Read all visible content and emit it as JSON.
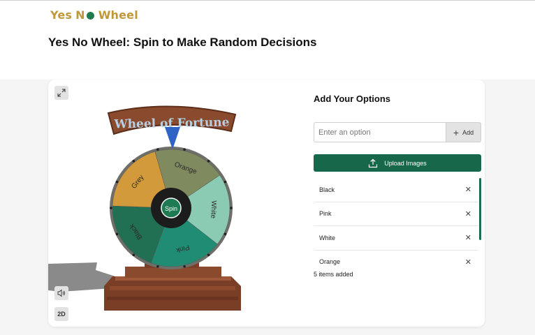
{
  "logo": {
    "part1": "Yes",
    "n": "N",
    "part2": "Wheel"
  },
  "page": {
    "title": "Yes No Wheel: Spin to Make Random Decisions"
  },
  "wheel": {
    "banner": "Wheel of Fortune",
    "spin_label": "Spin",
    "segments": [
      {
        "label": "Orange",
        "color": "#7f8a5f"
      },
      {
        "label": "White",
        "color": "#8ccbb3"
      },
      {
        "label": "Pink",
        "color": "#1f8c73"
      },
      {
        "label": "Black",
        "color": "#217053"
      },
      {
        "label": "Grey",
        "color": "#d39a3b"
      }
    ]
  },
  "controls": {
    "expand_icon": "expand-icon",
    "sound_icon": "speaker-icon",
    "mode_label": "2D"
  },
  "options": {
    "title": "Add Your Options",
    "input_placeholder": "Enter an option",
    "add_label": "Add",
    "upload_label": "Upload Images",
    "items": [
      {
        "label": "Black"
      },
      {
        "label": "Pink"
      },
      {
        "label": "White"
      },
      {
        "label": "Orange"
      }
    ],
    "count_text": "5 items added"
  },
  "colors": {
    "brand_gold": "#c0983a",
    "brand_green": "#17684a"
  }
}
